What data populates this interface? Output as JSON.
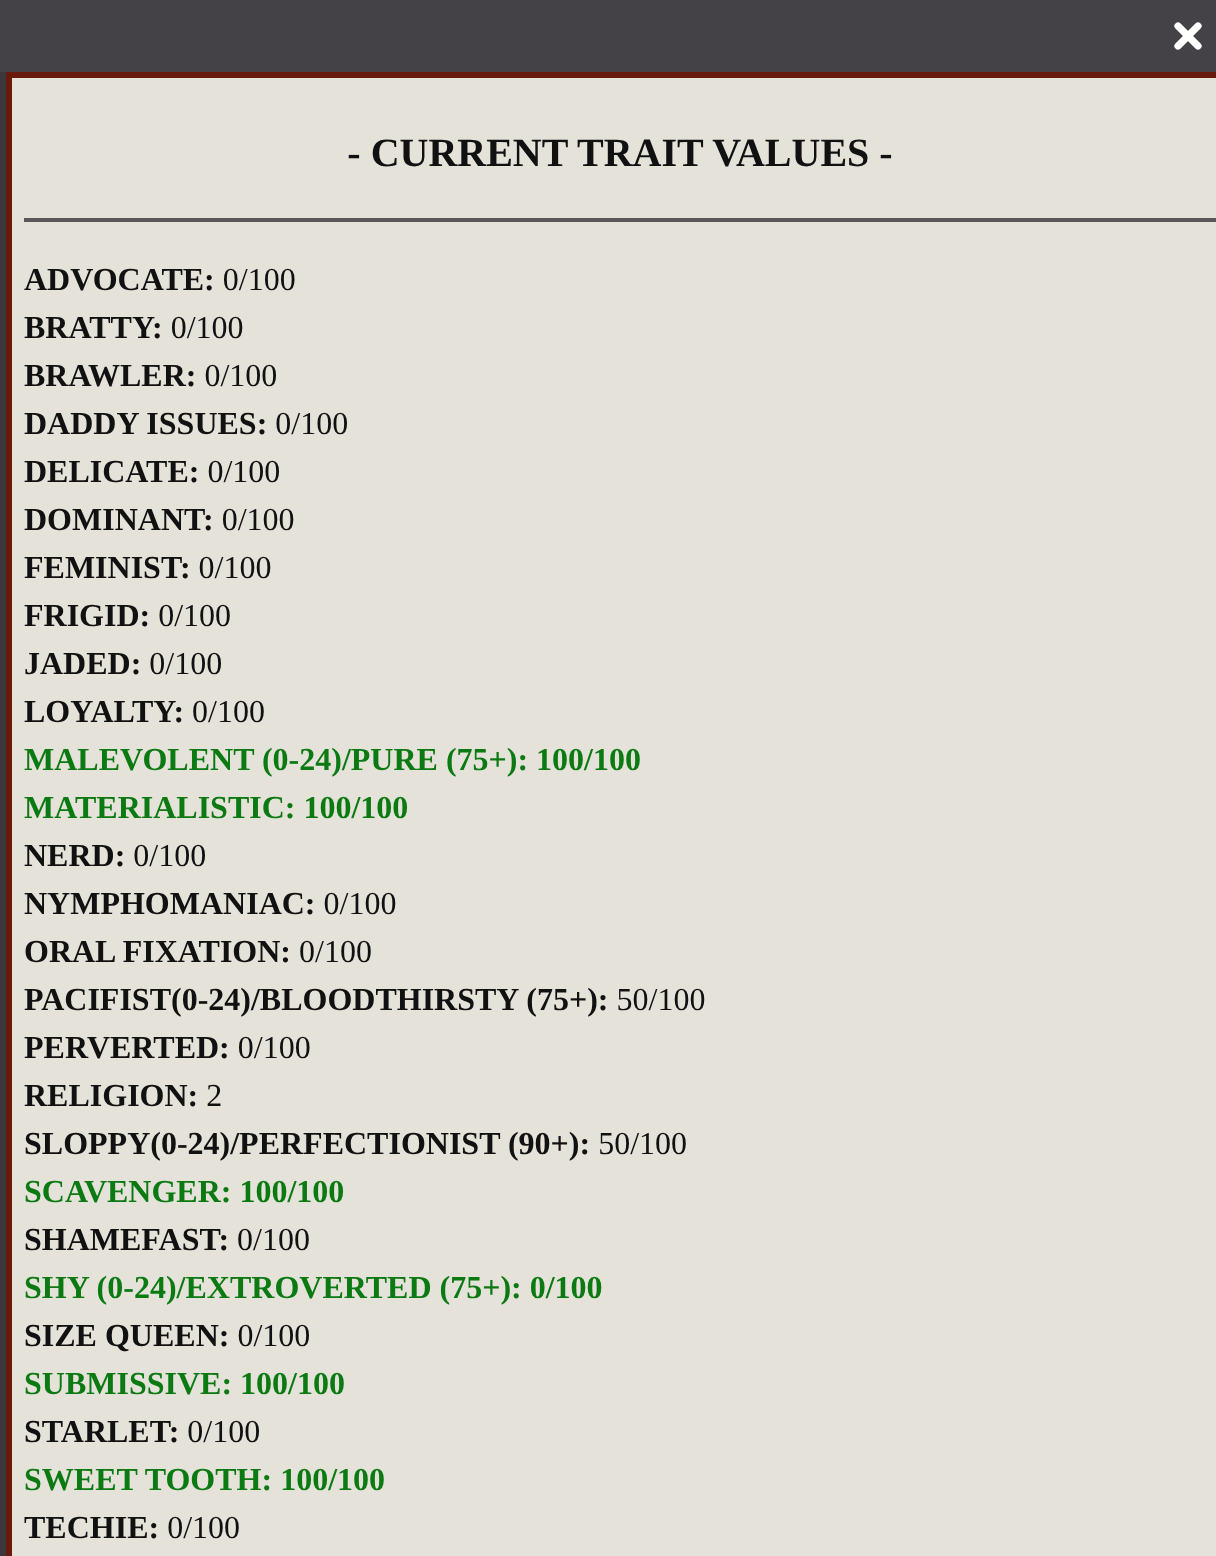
{
  "dialog": {
    "title": "- CURRENT TRAIT VALUES -"
  },
  "traits": [
    {
      "label": "ADVOCATE:",
      "value": "0/100",
      "highlighted": false
    },
    {
      "label": "BRATTY:",
      "value": "0/100",
      "highlighted": false
    },
    {
      "label": "BRAWLER:",
      "value": "0/100",
      "highlighted": false
    },
    {
      "label": "DADDY ISSUES:",
      "value": "0/100",
      "highlighted": false
    },
    {
      "label": "DELICATE:",
      "value": "0/100",
      "highlighted": false
    },
    {
      "label": "DOMINANT:",
      "value": "0/100",
      "highlighted": false
    },
    {
      "label": "FEMINIST:",
      "value": "0/100",
      "highlighted": false
    },
    {
      "label": "FRIGID:",
      "value": "0/100",
      "highlighted": false
    },
    {
      "label": "JADED:",
      "value": "0/100",
      "highlighted": false
    },
    {
      "label": "LOYALTY:",
      "value": "0/100",
      "highlighted": false
    },
    {
      "label": "MALEVOLENT (0-24)/PURE (75+):",
      "value": "100/100",
      "highlighted": true
    },
    {
      "label": "MATERIALISTIC:",
      "value": "100/100",
      "highlighted": true
    },
    {
      "label": "NERD:",
      "value": "0/100",
      "highlighted": false
    },
    {
      "label": "NYMPHOMANIAC:",
      "value": "0/100",
      "highlighted": false
    },
    {
      "label": "ORAL FIXATION:",
      "value": "0/100",
      "highlighted": false
    },
    {
      "label": "PACIFIST(0-24)/BLOODTHIRSTY (75+):",
      "value": "50/100",
      "highlighted": false
    },
    {
      "label": "PERVERTED:",
      "value": "0/100",
      "highlighted": false
    },
    {
      "label": "RELIGION:",
      "value": "2",
      "highlighted": false
    },
    {
      "label": "SLOPPY(0-24)/PERFECTIONIST (90+):",
      "value": "50/100",
      "highlighted": false
    },
    {
      "label": "SCAVENGER:",
      "value": "100/100",
      "highlighted": true
    },
    {
      "label": "SHAMEFAST:",
      "value": "0/100",
      "highlighted": false
    },
    {
      "label": "SHY (0-24)/EXTROVERTED (75+):",
      "value": "0/100",
      "highlighted": true
    },
    {
      "label": "SIZE QUEEN:",
      "value": "0/100",
      "highlighted": false
    },
    {
      "label": "SUBMISSIVE:",
      "value": "100/100",
      "highlighted": true
    },
    {
      "label": "STARLET:",
      "value": "0/100",
      "highlighted": false
    },
    {
      "label": "SWEET TOOTH:",
      "value": "100/100",
      "highlighted": true
    },
    {
      "label": "TECHIE:",
      "value": "0/100",
      "highlighted": false
    }
  ]
}
